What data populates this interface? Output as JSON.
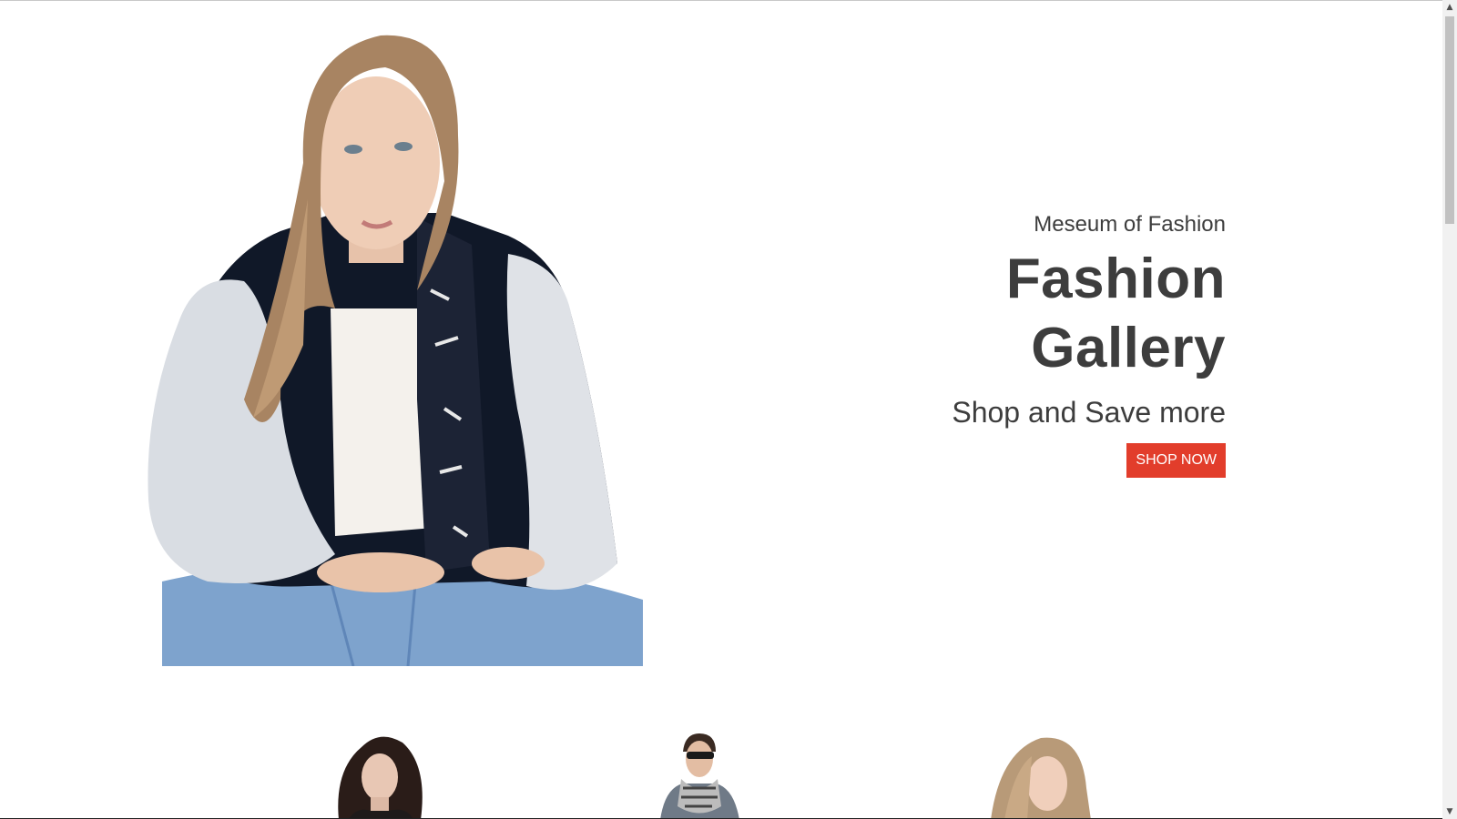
{
  "hero": {
    "kicker": "Meseum of Fashion",
    "title_line1": "Fashion",
    "title_line2": "Gallery",
    "subtitle": "Shop and Save more",
    "cta_label": "SHOP NOW"
  },
  "colors": {
    "accent": "#e23d2b",
    "text": "#3d3d3d",
    "background": "#ffffff"
  },
  "scrollbar": {
    "up_icon": "▲",
    "down_icon": "▼"
  }
}
